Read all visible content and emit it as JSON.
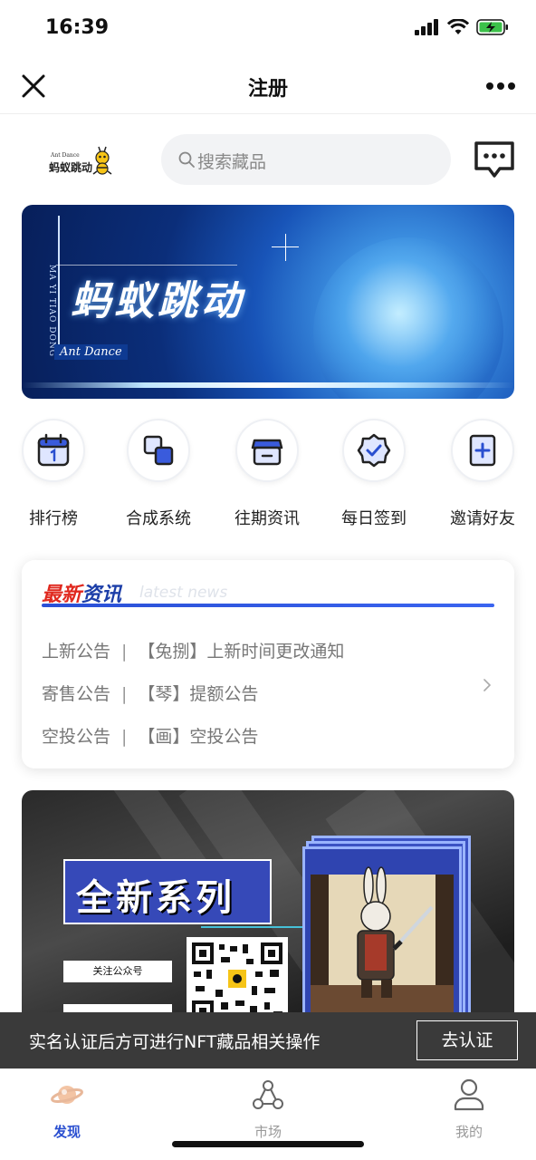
{
  "status_bar": {
    "time": "16:39"
  },
  "navbar": {
    "title": "注册"
  },
  "header": {
    "logo_en": "Ant Dance",
    "logo_cn": "蚂蚁跳动",
    "search_placeholder": "搜索藏品"
  },
  "banner": {
    "vertical_text": "MA YI TIAO DONG",
    "title": "蚂蚁跳动",
    "subtitle": "Ant Dance"
  },
  "quick_links": [
    {
      "label": "排行榜",
      "icon": "calendar-icon"
    },
    {
      "label": "合成系统",
      "icon": "merge-icon"
    },
    {
      "label": "往期资讯",
      "icon": "store-icon"
    },
    {
      "label": "每日签到",
      "icon": "badge-check-icon"
    },
    {
      "label": "邀请好友",
      "icon": "invite-icon"
    }
  ],
  "news": {
    "title_red": "最新",
    "title_blue": "资讯",
    "title_en": "latest news",
    "items": [
      {
        "category": "上新公告",
        "separator": "|",
        "text": "【兔捌】上新时间更改通知"
      },
      {
        "category": "寄售公告",
        "separator": "|",
        "text": "【琴】提额公告"
      },
      {
        "category": "空投公告",
        "separator": "|",
        "text": "【画】空投公告"
      }
    ]
  },
  "promo": {
    "title": "全新系列",
    "follow_label": "关注公众号"
  },
  "notice": {
    "text": "实名认证后方可进行NFT藏品相关操作",
    "button": "去认证"
  },
  "tabbar": {
    "tabs": [
      {
        "label": "发现",
        "active": true
      },
      {
        "label": "市场",
        "active": false
      },
      {
        "label": "我的",
        "active": false
      }
    ]
  },
  "colors": {
    "accent": "#2a4fd0",
    "news_red": "#e0281e",
    "news_blue": "#1c3ea8",
    "notice_bg": "#3a3a3a"
  }
}
